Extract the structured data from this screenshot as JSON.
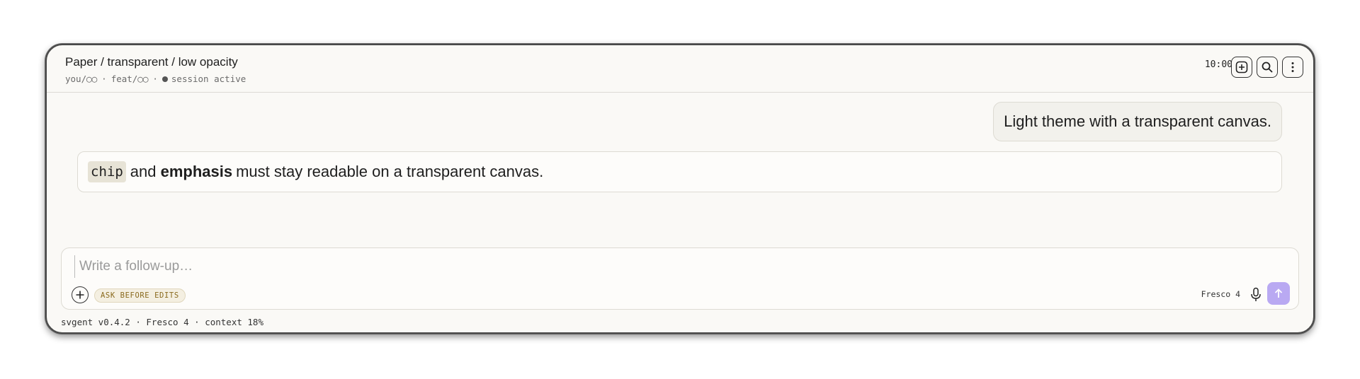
{
  "header": {
    "title": "Paper / transparent / low opacity",
    "user": "you/◯◯",
    "branch": "feat/◯◯",
    "separator": "·",
    "status": "session active",
    "time": "10:00",
    "icons": [
      "new-chat-icon",
      "search-icon",
      "more-vertical-icon"
    ]
  },
  "messages": {
    "user": "Light theme with a transparent canvas.",
    "assistant": {
      "chip": "chip",
      "part1": "and",
      "emphasis": "emphasis",
      "part2": "must stay readable on a transparent canvas."
    }
  },
  "composer": {
    "placeholder": "Write a follow-up…",
    "mode_badge": "ASK BEFORE EDITS",
    "model": "Fresco 4",
    "icons": [
      "plus-icon",
      "mic-icon",
      "arrow-up-icon"
    ],
    "send_color": "#b9a9f2"
  },
  "footer": {
    "status": "svgent v0.4.2 · Fresco 4 · context 18%"
  }
}
